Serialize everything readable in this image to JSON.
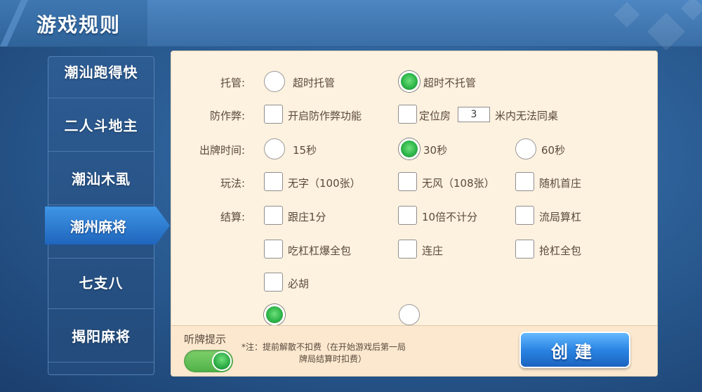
{
  "header": {
    "title": "游戏规则"
  },
  "sidebar": {
    "items": [
      {
        "label": "潮汕跑得快"
      },
      {
        "label": "二人斗地主"
      },
      {
        "label": "潮汕木虱"
      },
      {
        "label": "潮州麻将",
        "selected": true
      },
      {
        "label": "七支八"
      },
      {
        "label": "揭阳麻将"
      }
    ]
  },
  "rules": {
    "tuoguan": {
      "label": "托管:",
      "options": [
        {
          "label": "超时托管",
          "selected": false
        },
        {
          "label": "超时不托管",
          "selected": true
        }
      ]
    },
    "anticheat": {
      "label": "防作弊:",
      "options": [
        {
          "label": "开启防作弊功能",
          "checked": false
        },
        {
          "label": "定位房",
          "checked": false
        }
      ],
      "distance_value": "3",
      "distance_suffix": "米内无法同桌"
    },
    "play_time": {
      "label": "出牌时间:",
      "options": [
        {
          "label": "15秒",
          "selected": false
        },
        {
          "label": "30秒",
          "selected": true
        },
        {
          "label": "60秒",
          "selected": false
        }
      ]
    },
    "gameplay": {
      "label": "玩法:",
      "options": [
        {
          "label": "无字（100张）",
          "checked": false
        },
        {
          "label": "无风（108张）",
          "checked": false
        },
        {
          "label": "随机首庄",
          "checked": false
        }
      ]
    },
    "settlement": {
      "label": "结算:",
      "options": [
        {
          "label": "跟庄1分",
          "checked": false
        },
        {
          "label": "10倍不计分",
          "checked": false
        },
        {
          "label": "流局算杠",
          "checked": false
        },
        {
          "label": "吃杠杠爆全包",
          "checked": false
        },
        {
          "label": "连庄",
          "checked": false
        },
        {
          "label": "抢杠全包",
          "checked": false
        },
        {
          "label": "必胡",
          "checked": false
        }
      ]
    }
  },
  "footer": {
    "tip_label": "听牌提示",
    "tip_enabled": true,
    "note_line1": "*注：提前解散不扣费（在开始游戏后第一局",
    "note_line2": "牌局结算时扣费）",
    "create_label": "创建"
  },
  "colors": {
    "accent_green": "#2eb64a",
    "button_blue": "#2b84e2",
    "panel_bg": "#fdf1df"
  }
}
